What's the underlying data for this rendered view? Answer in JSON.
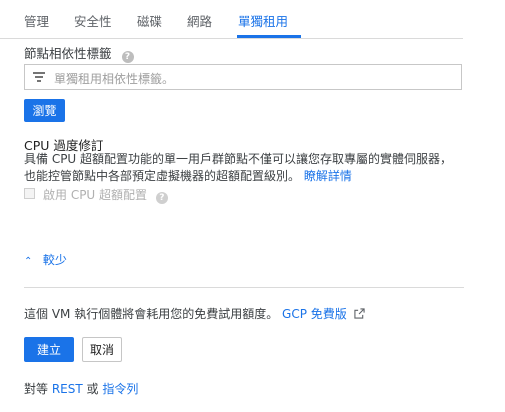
{
  "tabs": [
    {
      "label": "管理"
    },
    {
      "label": "安全性"
    },
    {
      "label": "磁碟"
    },
    {
      "label": "網路"
    },
    {
      "label": "單獨租用"
    }
  ],
  "active_tab": "單獨租用",
  "node_affinity": {
    "label": "節點相依性標籤",
    "placeholder": "單獨租用相依性標籤。",
    "browse_button": "瀏覽"
  },
  "cpu_overcommit": {
    "heading": "CPU 過度修訂",
    "description": "具備 CPU 超額配置功能的單一用戶群節點不僅可以讓您存取專屬的實體伺服器，也能控管節點中各部預定虛擬機器的超額配置級別。",
    "learn_more": "瞭解詳情",
    "checkbox_label": "啟用 CPU 超額配置",
    "checkbox_checked": false
  },
  "less_link": "較少",
  "free_trial": {
    "text": "這個 VM 執行個體將會耗用您的免費試用額度。",
    "link": "GCP 免費版"
  },
  "actions": {
    "create": "建立",
    "cancel": "取消"
  },
  "equivalent": {
    "prefix": "對等",
    "rest": "REST",
    "or": "或",
    "command_line": "指令列"
  },
  "colors": {
    "accent": "#1a73e8",
    "text": "#212121",
    "disabled": "#b0b0b0"
  }
}
